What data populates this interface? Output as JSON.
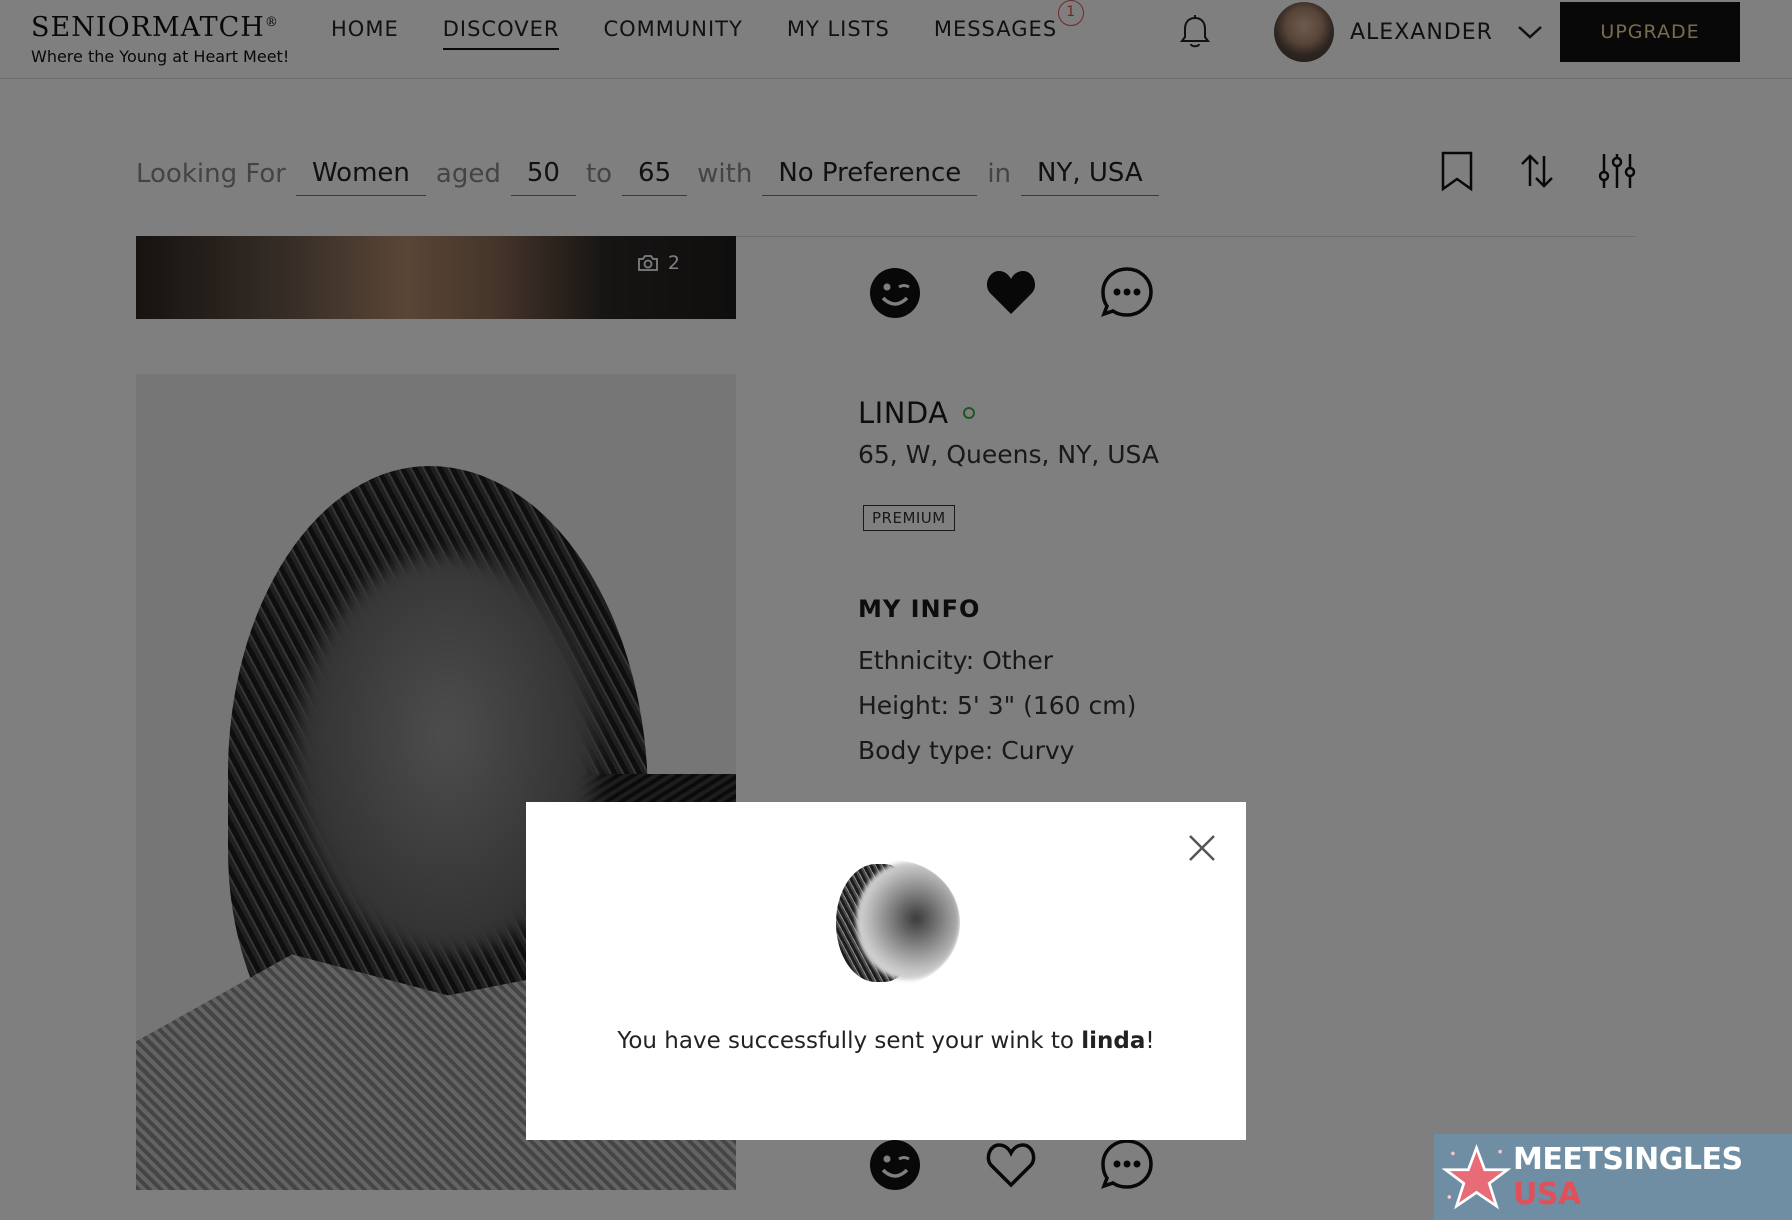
{
  "brand": {
    "name": "SENIORMATCH",
    "registered": "®",
    "tagline": "Where the Young at Heart Meet!"
  },
  "nav": {
    "items": [
      {
        "label": "HOME",
        "active": false
      },
      {
        "label": "DISCOVER",
        "active": true
      },
      {
        "label": "COMMUNITY",
        "active": false
      },
      {
        "label": "MY LISTS",
        "active": false
      },
      {
        "label": "MESSAGES",
        "active": false,
        "badge": "1"
      }
    ]
  },
  "notifications": {
    "icon": "bell-icon"
  },
  "user": {
    "name": "ALEXANDER",
    "menu_icon": "chevron-down-icon"
  },
  "upgrade_label": "UPGRADE",
  "search": {
    "looking_for_label": "Looking For",
    "gender": "Women",
    "aged_label": "aged",
    "age_min": "50",
    "to_label": "to",
    "age_max": "65",
    "with_label": "with",
    "preference": "No Preference",
    "in_label": "in",
    "location": "NY,  USA",
    "tools": [
      "bookmark-icon",
      "sort-icon",
      "filter-sliders-icon"
    ]
  },
  "profile": {
    "photo_count": "2",
    "name": "LINDA",
    "online": true,
    "meta": "65, W, Queens, NY, USA",
    "badge": "PREMIUM",
    "info_title": "MY INFO",
    "info": [
      "Ethnicity: Other",
      "Height: 5' 3\" (160 cm)",
      "Body type: Curvy"
    ],
    "top_actions": [
      "wink-icon",
      "heart-filled-icon",
      "message-icon"
    ],
    "bottom_actions": [
      "wink-icon",
      "heart-outline-icon",
      "message-icon"
    ]
  },
  "modal": {
    "text_prefix": "You have successfully sent your wink to ",
    "text_name": "linda",
    "text_suffix": "!",
    "close_icon": "close-icon"
  },
  "watermark": {
    "text_main": "MEETSINGLES",
    "text_accent": "USA"
  },
  "colors": {
    "upgrade_bg": "#111111",
    "upgrade_text": "#f3d79a",
    "badge_red": "#e54f4f",
    "online_green": "#3fae48",
    "overlay": "rgba(0,0,0,0.5)",
    "watermark_bg": "#6f8ea4"
  }
}
